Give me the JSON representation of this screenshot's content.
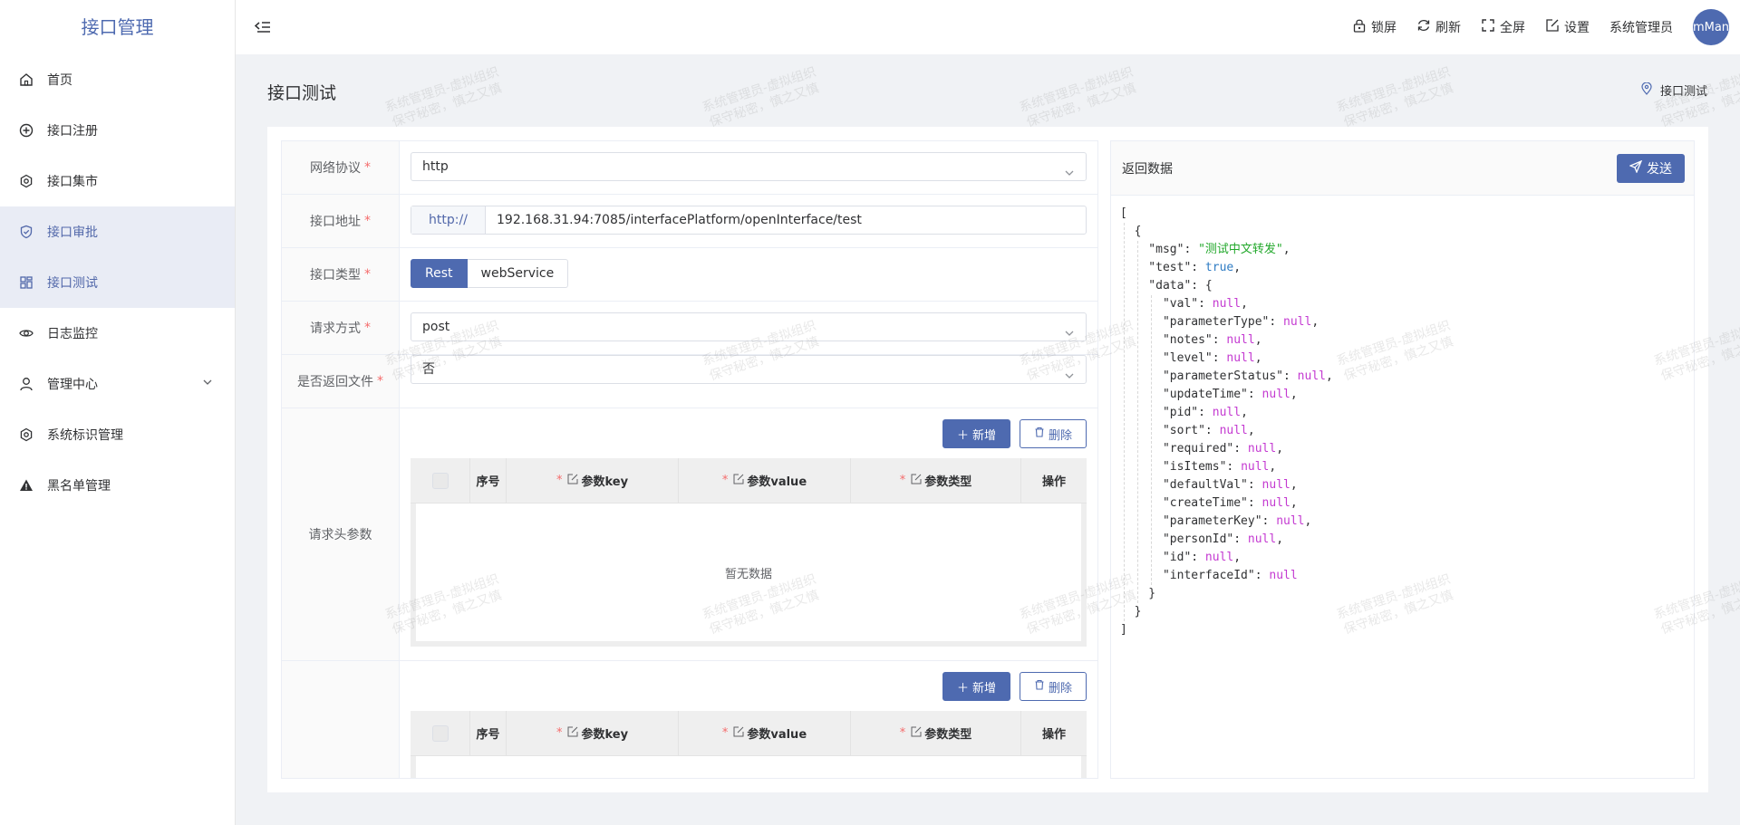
{
  "app": {
    "title": "接口管理"
  },
  "sidebar": {
    "items": [
      {
        "label": "首页"
      },
      {
        "label": "接口注册"
      },
      {
        "label": "接口集市"
      },
      {
        "label": "接口审批"
      },
      {
        "label": "接口测试"
      },
      {
        "label": "日志监控"
      },
      {
        "label": "管理中心"
      },
      {
        "label": "系统标识管理"
      },
      {
        "label": "黑名单管理"
      }
    ]
  },
  "header": {
    "lock": "锁屏",
    "refresh": "刷新",
    "fullscreen": "全屏",
    "settings": "设置",
    "user": "系统管理员",
    "avatar_text": "mMan"
  },
  "page": {
    "title": "接口测试",
    "breadcrumb": "接口测试"
  },
  "form": {
    "protocol": {
      "label": "网络协议",
      "value": "http"
    },
    "address": {
      "label": "接口地址",
      "prefix": "http://",
      "value": "192.168.31.94:7085/interfacePlatform/openInterface/test"
    },
    "type": {
      "label": "接口类型",
      "options": [
        "Rest",
        "webService"
      ]
    },
    "method": {
      "label": "请求方式",
      "value": "post"
    },
    "return_file": {
      "label": "是否返回文件",
      "value": "否"
    },
    "headers": {
      "label": "请求头参数",
      "add": "新增",
      "delete": "删除",
      "empty": "暂无数据"
    },
    "body": {
      "add": "新增",
      "delete": "删除"
    },
    "columns": {
      "index": "序号",
      "key": "参数key",
      "value": "参数value",
      "type": "参数类型",
      "ops": "操作"
    }
  },
  "response": {
    "title": "返回数据",
    "send": "发送"
  },
  "watermark": {
    "line1": "系统管理员-虚拟组织",
    "line2": "保守秘密，慎之又慎"
  },
  "colors": {
    "primary": "#4e6ab0",
    "required": "#f56c6c",
    "string": "#22a82b",
    "bool": "#2f7cc4",
    "null": "#c43ad1"
  }
}
